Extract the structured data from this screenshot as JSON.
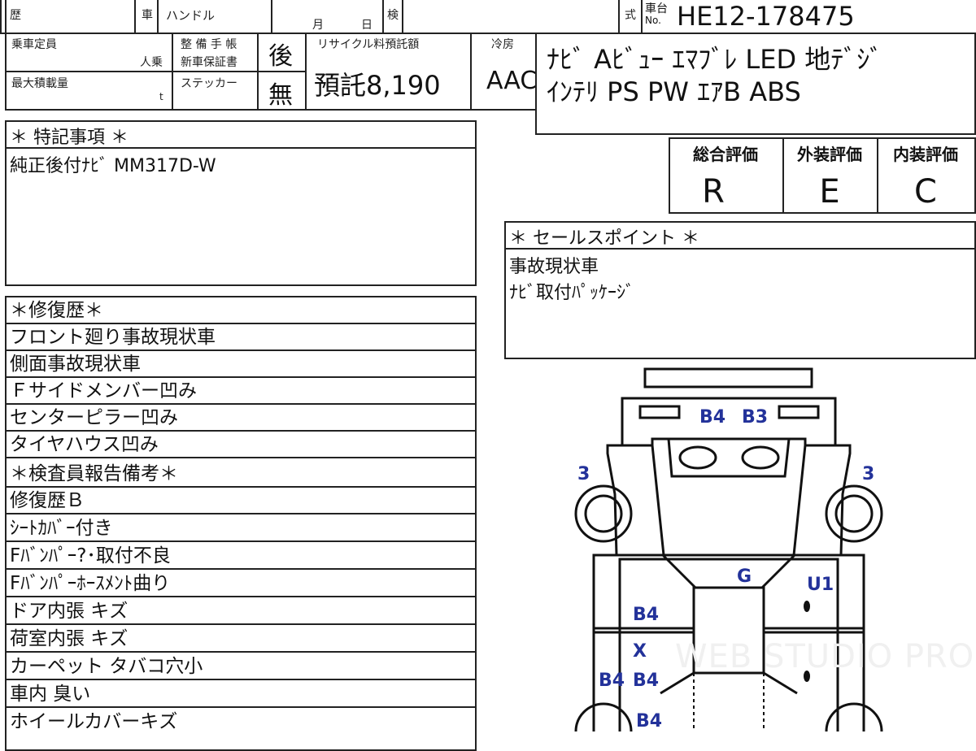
{
  "header": {
    "reki_label": "歴",
    "sha_label": "車",
    "handle_label": "ハンドル",
    "month_label": "月",
    "day_label": "日",
    "ken_label": "検",
    "shiki_label": "式",
    "chassis_label_top": "車台",
    "chassis_label_no": "No.",
    "chassis_no": "HE12-178475"
  },
  "spec": {
    "capacity_label": "乗車定員",
    "capacity_unit": "人乗",
    "load_label": "最大積載量",
    "load_unit": "t",
    "maintenance_label": "整 備 手 帳",
    "warranty_label": "新車保証書",
    "sticker_label": "ステッカー",
    "maintenance_value": "後",
    "sticker_value": "無",
    "recycle_label": "リサイクル料預託額",
    "recycle_value": "預託8,190",
    "cooler_label": "冷房",
    "cooler_value": "AAC"
  },
  "equipment": {
    "line1": "ﾅﾋﾞ Aﾋﾞｭｰ ｴﾏﾌﾞﾚ LED 地ﾃﾞｼﾞ",
    "line2": "ｲﾝﾃﾘ PS PW ｴｱB ABS"
  },
  "special_notes": {
    "title": "＊ 特記事項 ＊",
    "text": "純正後付ﾅﾋﾞ MM317D-W"
  },
  "grades": {
    "overall_label": "総合評価",
    "exterior_label": "外装評価",
    "interior_label": "内装評価",
    "overall": "R",
    "exterior": "E",
    "interior": "C"
  },
  "sale_points": {
    "title": "＊ セールスポイント ＊",
    "line1": "事故現状車",
    "line2": "ﾅﾋﾞ取付ﾊﾟｯｹｰｼﾞ"
  },
  "repair_list": [
    "＊修復歴＊",
    "フロント廻り事故現状車",
    "側面事故現状車",
    "Ｆサイドメンバー凹み",
    "センターピラー凹み",
    "タイヤハウス凹み",
    "＊検査員報告備考＊",
    "修復歴Ｂ",
    "ｼｰﾄｶﾊﾞｰ付き",
    "Fﾊﾞﾝﾊﾟｰ?･取付不良",
    "Fﾊﾞﾝﾊﾟｰﾎｰｽﾒﾝﾄ曲り",
    "ドア内張 キズ",
    "荷室内張 キズ",
    "カーペット タバコ穴小",
    "車内 臭い",
    "ホイールカバーキズ"
  ],
  "diagram": {
    "marks": {
      "b4_top": "B4",
      "b3_top": "B3",
      "three_left": "3",
      "three_right": "3",
      "g": "G",
      "u1": "U1",
      "b4_left_1": "B4",
      "x": "X",
      "b4_left_2a": "B4",
      "b4_left_2b": "B4",
      "b4_bottom": "B4"
    },
    "mark_color": "#23329a",
    "watermark": "WEB STUDIO PRO"
  }
}
